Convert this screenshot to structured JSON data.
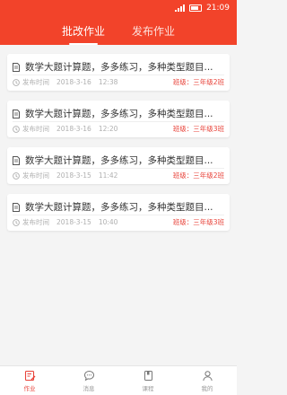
{
  "status": {
    "time": "21:09"
  },
  "header": {
    "tabs": [
      {
        "label": "批改作业",
        "active": true
      },
      {
        "label": "发布作业",
        "active": false
      }
    ]
  },
  "assignments": [
    {
      "title": "数学大题计算题，多多练习，多种类型题目...",
      "time_label": "发布时间",
      "date": "2018-3-16",
      "time": "12:38",
      "class": "班级：三年级2班"
    },
    {
      "title": "数学大题计算题，多多练习，多种类型题目...",
      "time_label": "发布时间",
      "date": "2018-3-16",
      "time": "12:20",
      "class": "班级：三年级3班"
    },
    {
      "title": "数学大题计算题，多多练习，多种类型题目...",
      "time_label": "发布时间",
      "date": "2018-3-15",
      "time": "11:42",
      "class": "班级：三年级2班"
    },
    {
      "title": "数学大题计算题，多多练习，多种类型题目...",
      "time_label": "发布时间",
      "date": "2018-3-15",
      "time": "10:40",
      "class": "班级：三年级3班"
    }
  ],
  "tabbar": {
    "items": [
      {
        "label": "作业",
        "icon": "homework-icon",
        "active": true
      },
      {
        "label": "消息",
        "icon": "message-icon",
        "active": false
      },
      {
        "label": "课程",
        "icon": "course-icon",
        "active": false
      },
      {
        "label": "我的",
        "icon": "profile-icon",
        "active": false
      }
    ]
  },
  "colors": {
    "accent": "#f2432a",
    "class_text": "#e8433a",
    "background": "#f4f4f4"
  }
}
